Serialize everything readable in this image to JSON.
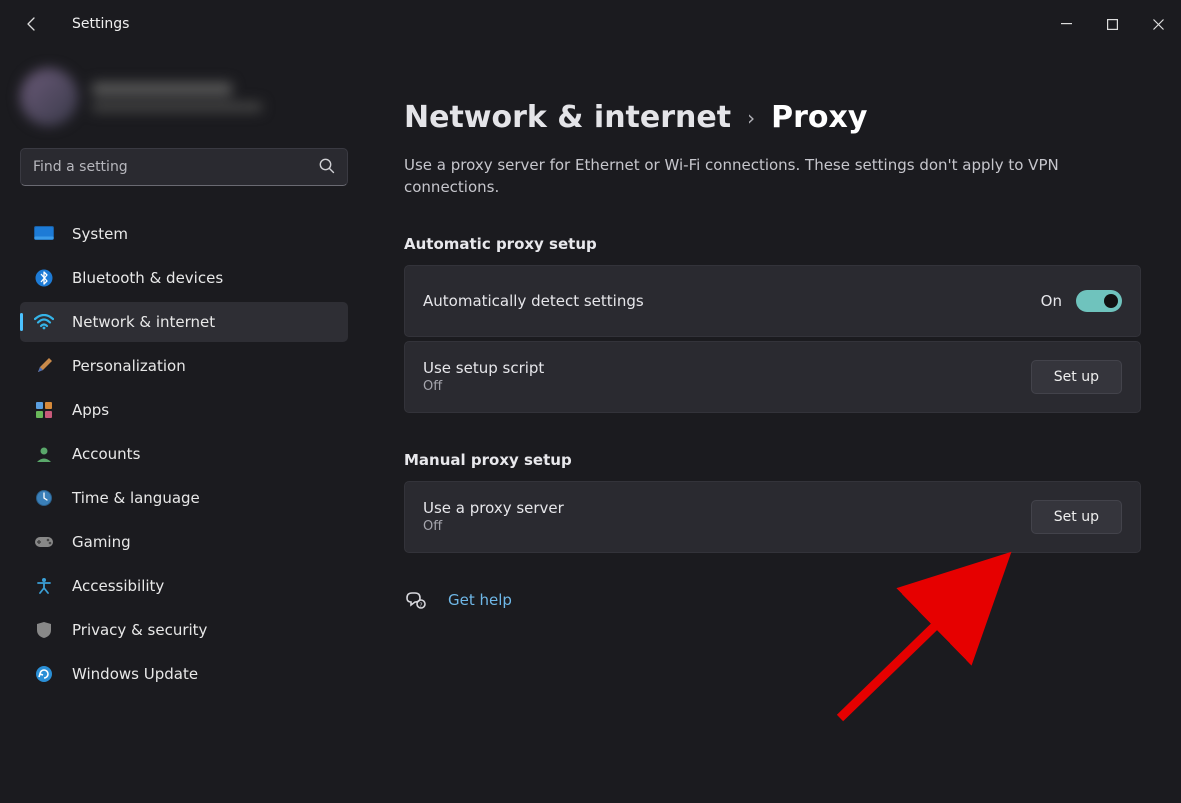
{
  "titlebar": {
    "title": "Settings"
  },
  "search": {
    "placeholder": "Find a setting"
  },
  "sidebar": {
    "items": [
      {
        "label": "System"
      },
      {
        "label": "Bluetooth & devices"
      },
      {
        "label": "Network & internet"
      },
      {
        "label": "Personalization"
      },
      {
        "label": "Apps"
      },
      {
        "label": "Accounts"
      },
      {
        "label": "Time & language"
      },
      {
        "label": "Gaming"
      },
      {
        "label": "Accessibility"
      },
      {
        "label": "Privacy & security"
      },
      {
        "label": "Windows Update"
      }
    ]
  },
  "breadcrumb": {
    "parent": "Network & internet",
    "current": "Proxy"
  },
  "description": "Use a proxy server for Ethernet or Wi-Fi connections. These settings don't apply to VPN connections.",
  "sections": {
    "auto": {
      "title": "Automatic proxy setup",
      "detect": {
        "label": "Automatically detect settings",
        "state": "On"
      },
      "script": {
        "label": "Use setup script",
        "state": "Off",
        "button": "Set up"
      }
    },
    "manual": {
      "title": "Manual proxy setup",
      "server": {
        "label": "Use a proxy server",
        "state": "Off",
        "button": "Set up"
      }
    }
  },
  "help": {
    "label": "Get help"
  }
}
